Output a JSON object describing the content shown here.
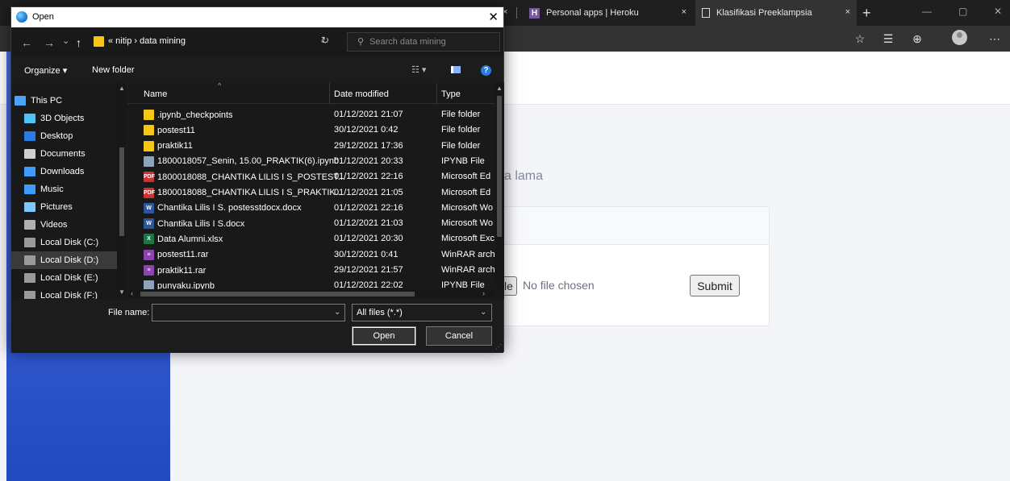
{
  "browser": {
    "tabs": [
      {
        "title": "Personal apps | Heroku"
      },
      {
        "title": "Klasifikasi Preeklampsia"
      }
    ],
    "tab_close": "×",
    "new_tab": "+",
    "window_controls": [
      "—",
      "▢",
      "✕"
    ],
    "toolbar_icons": [
      "☆",
      "☰",
      "⊕",
      "⋯"
    ]
  },
  "page": {
    "heading_fragment": "a lama",
    "file_input": {
      "button_fragment": "le",
      "status": "No file chosen"
    },
    "submit_label": "Submit"
  },
  "dialog": {
    "title": "Open",
    "close": "✕",
    "nav": {
      "back": "←",
      "forward": "→",
      "recent": "⌄",
      "up": "↑"
    },
    "path": {
      "crumbs": "« nitip  ›  data mining",
      "dropdown": "⌄",
      "refresh": "↻"
    },
    "search": {
      "icon": "⚲",
      "placeholder": "Search data mining"
    },
    "commands": {
      "organize": "Organize ▾",
      "new_folder": "New folder",
      "view": "☷ ▾",
      "help": "?"
    },
    "nav_pane": [
      {
        "label": "This PC",
        "icon": "pc-icon",
        "color": "#4aa3ff"
      },
      {
        "label": "3D Objects",
        "icon": "cube-icon",
        "color": "#4fc3f7"
      },
      {
        "label": "Desktop",
        "icon": "desktop-icon",
        "color": "#2b7be4"
      },
      {
        "label": "Documents",
        "icon": "documents-icon",
        "color": "#d0d0d0"
      },
      {
        "label": "Downloads",
        "icon": "downloads-icon",
        "color": "#3b9dff"
      },
      {
        "label": "Music",
        "icon": "music-icon",
        "color": "#3b9dff"
      },
      {
        "label": "Pictures",
        "icon": "pictures-icon",
        "color": "#7ec8ff"
      },
      {
        "label": "Videos",
        "icon": "videos-icon",
        "color": "#b0b0b0"
      },
      {
        "label": "Local Disk (C:)",
        "icon": "disk-icon",
        "color": "#9a9a9a"
      },
      {
        "label": "Local Disk (D:)",
        "icon": "disk-icon",
        "color": "#9a9a9a"
      },
      {
        "label": "Local Disk (E:)",
        "icon": "disk-icon",
        "color": "#9a9a9a"
      },
      {
        "label": "Local Disk (F:)",
        "icon": "disk-icon",
        "color": "#9a9a9a"
      }
    ],
    "selected_nav": "Local Disk (D:)",
    "columns": {
      "name": "Name",
      "date": "Date modified",
      "type": "Type"
    },
    "files": [
      {
        "name": ".ipynb_checkpoints",
        "date": "01/12/2021 21:07",
        "type": "File folder",
        "icon": "folder-icon",
        "color": "#f5c518",
        "glyph": ""
      },
      {
        "name": "postest11",
        "date": "30/12/2021 0:42",
        "type": "File folder",
        "icon": "folder-icon",
        "color": "#f5c518",
        "glyph": ""
      },
      {
        "name": "praktik11",
        "date": "29/12/2021 17:36",
        "type": "File folder",
        "icon": "folder-icon",
        "color": "#f5c518",
        "glyph": ""
      },
      {
        "name": "1800018057_Senin, 15.00_PRAKTIK(6).ipynb",
        "date": "01/12/2021 20:33",
        "type": "IPYNB File",
        "icon": "ipynb-file-icon",
        "color": "#8fa3b8",
        "glyph": ""
      },
      {
        "name": "1800018088_CHANTIKA LILIS I S_POSTEST...",
        "date": "01/12/2021 22:16",
        "type": "Microsoft Ed",
        "icon": "pdf-icon",
        "color": "#d32f2f",
        "glyph": "PDF"
      },
      {
        "name": "1800018088_CHANTIKA LILIS I S_PRAKTIK...",
        "date": "01/12/2021 21:05",
        "type": "Microsoft Ed",
        "icon": "pdf-icon",
        "color": "#d32f2f",
        "glyph": "PDF"
      },
      {
        "name": "Chantika Lilis I S. postesstdocx.docx",
        "date": "01/12/2021 22:16",
        "type": "Microsoft Wo",
        "icon": "word-icon",
        "color": "#2b579a",
        "glyph": "W"
      },
      {
        "name": "Chantika Lilis I S.docx",
        "date": "01/12/2021 21:03",
        "type": "Microsoft Wo",
        "icon": "word-icon",
        "color": "#2b579a",
        "glyph": "W"
      },
      {
        "name": "Data Alumni.xlsx",
        "date": "01/12/2021 20:30",
        "type": "Microsoft Exc",
        "icon": "excel-icon",
        "color": "#217346",
        "glyph": "X"
      },
      {
        "name": "postest11.rar",
        "date": "30/12/2021 0:41",
        "type": "WinRAR arch",
        "icon": "rar-icon",
        "color": "#8e44ad",
        "glyph": "≡"
      },
      {
        "name": "praktik11.rar",
        "date": "29/12/2021 21:57",
        "type": "WinRAR arch",
        "icon": "rar-icon",
        "color": "#8e44ad",
        "glyph": "≡"
      },
      {
        "name": "punyaku.ipynb",
        "date": "01/12/2021 22:02",
        "type": "IPYNB File",
        "icon": "ipynb-file-icon",
        "color": "#8fa3b8",
        "glyph": ""
      }
    ],
    "file_name_label": "File name:",
    "file_name_value": "",
    "filter_value": "All files (*.*)",
    "open_label": "Open",
    "cancel_label": "Cancel"
  }
}
